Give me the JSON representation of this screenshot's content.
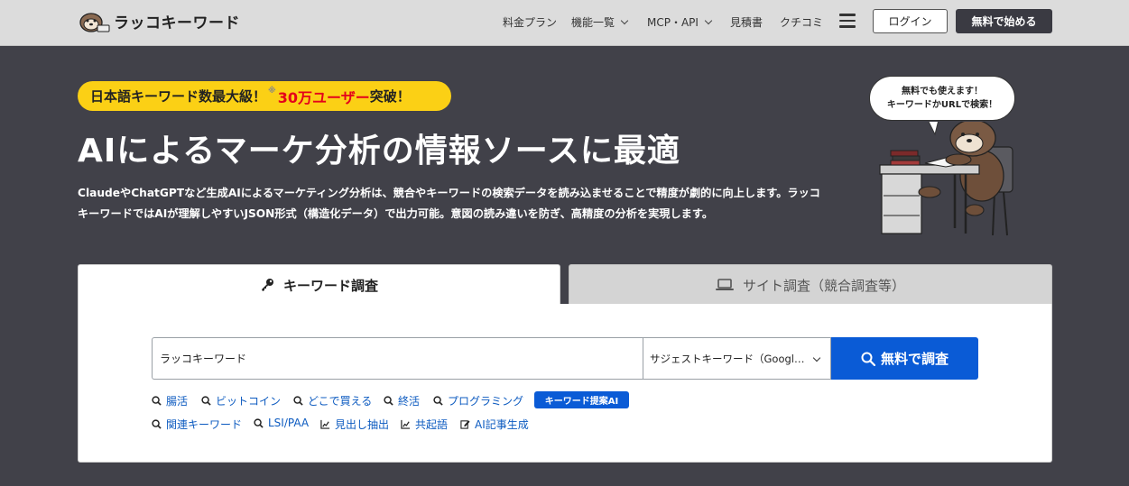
{
  "header": {
    "logo_text": "ラッコキーワード",
    "nav": {
      "pricing": "料金プラン",
      "features": "機能一覧",
      "mcp_api": "MCP・API",
      "estimate": "見積書",
      "reviews": "クチコミ"
    },
    "login_label": "ログイン",
    "start_free_label": "無料で始める"
  },
  "hero": {
    "badge": {
      "prefix": "日本語キーワード数最大級！",
      "note": "※",
      "highlight": "30万ユーザー",
      "suffix": "突破！"
    },
    "title": "AIによるマーケ分析の情報ソースに最適",
    "description": "ClaudeやChatGPTなど生成AIによるマーケティング分析は、競合やキーワードの検索データを読み込ませることで精度が劇的に向上します。ラッコキーワードではAIが理解しやすいJSON形式（構造化データ）で出力可能。意図の読み違いを防ぎ、高精度の分析を実現します。",
    "bubble_line1": "無料でも使えます！",
    "bubble_line2": "キーワードかURLで検索！"
  },
  "tabs": {
    "keyword": "キーワード調査",
    "site": "サイト調査（競合調査等）"
  },
  "search": {
    "value": "ラッコキーワード",
    "select_value": "サジェストキーワード（Googl…",
    "button_label": "無料で調査"
  },
  "suggestions": {
    "row1": [
      "腸活",
      "ビットコイン",
      "どこで買える",
      "終活",
      "プログラミング"
    ],
    "ai_pill": "キーワード提案AI",
    "row2": {
      "related": "関連キーワード",
      "lsi": "LSI/PAA",
      "headings": "見出し抽出",
      "cooccur": "共起語",
      "ai_article": "AI記事生成"
    }
  },
  "colors": {
    "background": "#414149",
    "accent_blue": "#0a5bd6",
    "badge_yellow": "#fbd015",
    "highlight_red": "#e4001b"
  }
}
